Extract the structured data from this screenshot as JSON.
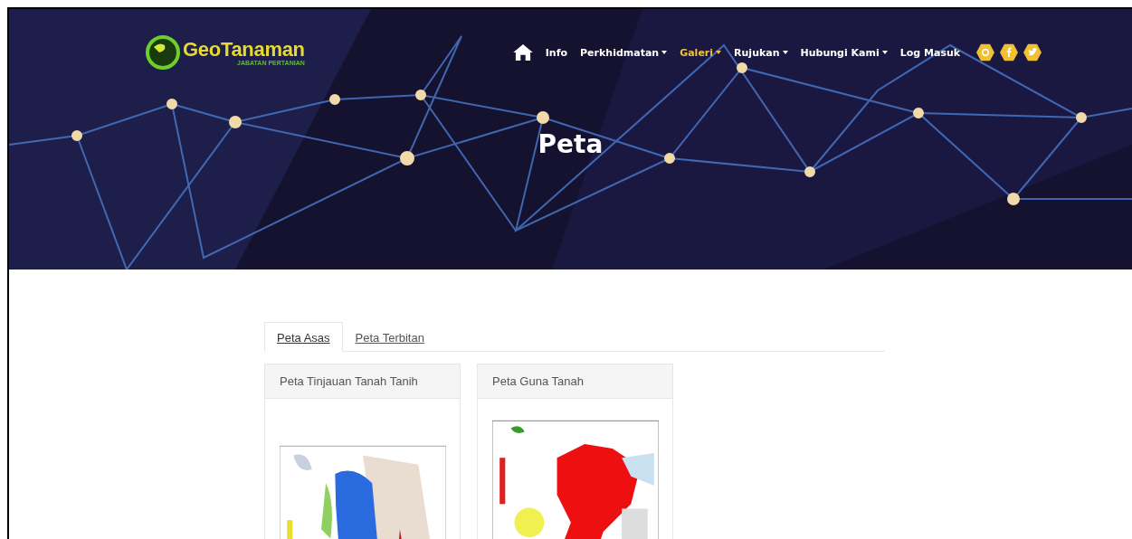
{
  "logo": {
    "name": "GeoTanaman",
    "subtitle": "JABATAN PERTANIAN"
  },
  "nav": [
    {
      "label": "Info",
      "dropdown": false,
      "selected": false
    },
    {
      "label": "Perkhidmatan",
      "dropdown": true,
      "selected": false
    },
    {
      "label": "Galeri",
      "dropdown": true,
      "selected": true
    },
    {
      "label": "Rujukan",
      "dropdown": true,
      "selected": false
    },
    {
      "label": "Hubungi Kami",
      "dropdown": true,
      "selected": false
    },
    {
      "label": "Log Masuk",
      "dropdown": false,
      "selected": false
    }
  ],
  "hero": {
    "title": "Peta"
  },
  "tabs": [
    {
      "label": "Peta Asas",
      "selected": true
    },
    {
      "label": "Peta Terbitan",
      "selected": false
    }
  ],
  "cards": [
    {
      "title": "Peta Tinjauan Tanah Tanih"
    },
    {
      "title": "Peta Guna Tanah"
    }
  ]
}
